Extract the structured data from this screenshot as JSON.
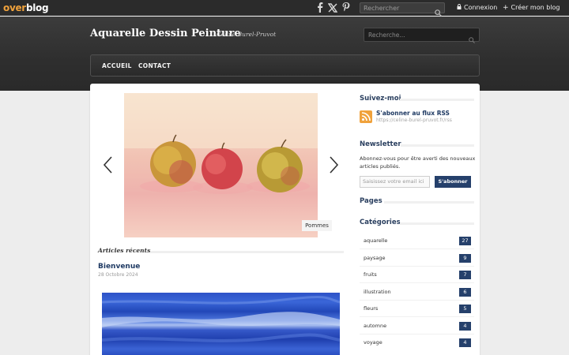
{
  "topbar": {
    "logo_part1": "over",
    "logo_part2": "blog",
    "social": [
      "facebook-icon",
      "x-icon",
      "pinterest-icon"
    ],
    "search_placeholder": "Rechercher",
    "login_label": "Connexion",
    "create_label": "Créer mon blog"
  },
  "header": {
    "title": "Aquarelle Dessin Peinture",
    "subtitle": "Céline Burel-Pruvot",
    "search_placeholder": "Recherche..."
  },
  "nav": {
    "items": [
      {
        "label": "ACCUEIL"
      },
      {
        "label": "CONTACT"
      }
    ]
  },
  "slider": {
    "caption": "Pommes"
  },
  "recent": {
    "heading": "Articles récents",
    "posts": [
      {
        "title": "Bienvenue",
        "date": "28 Octobre 2024"
      }
    ]
  },
  "sidebar": {
    "follow_heading": "Suivez-moi",
    "rss_title": "S'abonner au flux RSS",
    "rss_url": "https://celine-burel-pruvot.fr/rss",
    "newsletter_heading": "Newsletter",
    "newsletter_text": "Abonnez-vous pour être averti des nouveaux articles publiés.",
    "newsletter_placeholder": "Saisissez votre email ici",
    "newsletter_button": "S'abonner",
    "pages_heading": "Pages",
    "categories_heading": "Catégories",
    "categories": [
      {
        "name": "aquarelle",
        "count": "27"
      },
      {
        "name": "paysage",
        "count": "9"
      },
      {
        "name": "fruits",
        "count": "7"
      },
      {
        "name": "illustration",
        "count": "6"
      },
      {
        "name": "fleurs",
        "count": "5"
      },
      {
        "name": "automne",
        "count": "4"
      },
      {
        "name": "voyage",
        "count": "4"
      }
    ]
  },
  "colors": {
    "brand_orange": "#f0a23c",
    "navy": "#25406b",
    "topbar": "#2b2b2b"
  }
}
